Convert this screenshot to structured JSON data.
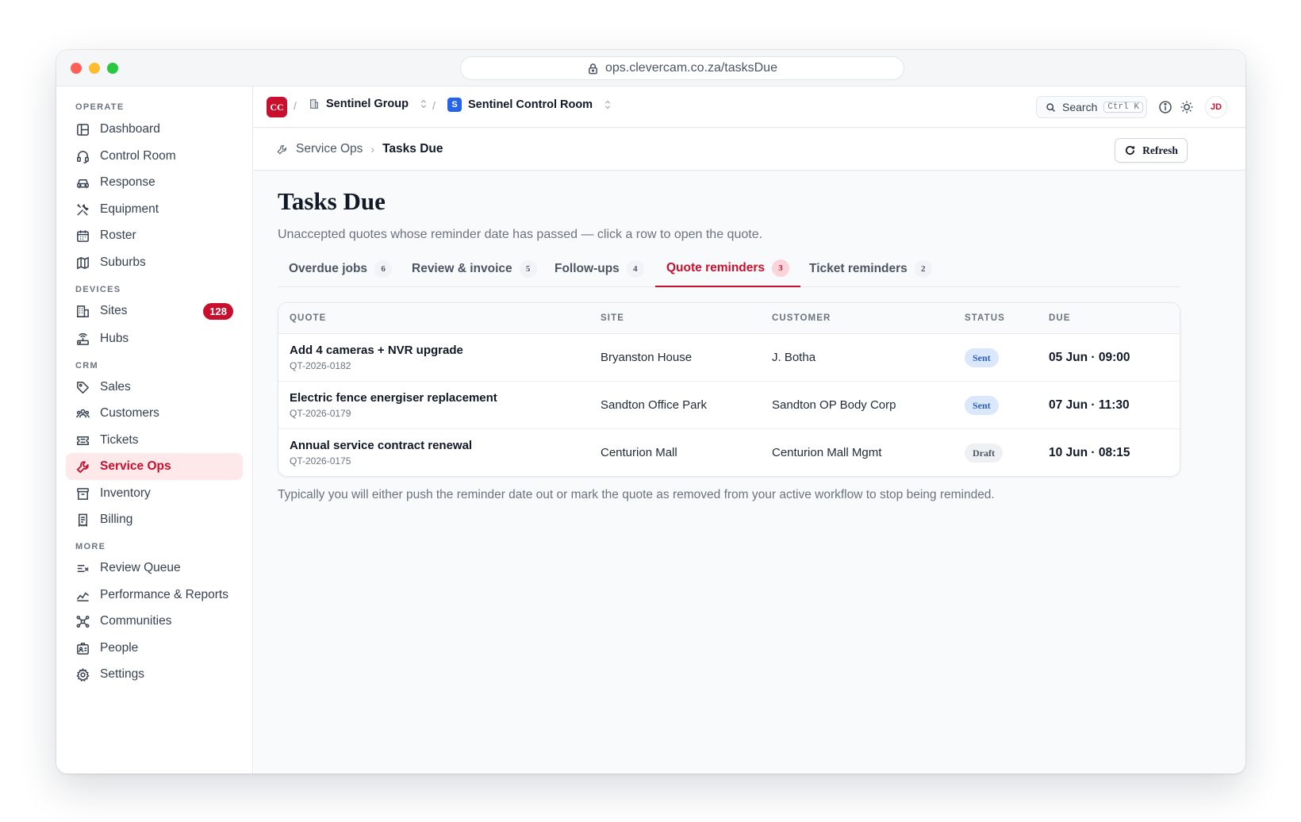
{
  "browser": {
    "url": "ops.clevercam.co.za/tasksDue"
  },
  "sidebar": {
    "sections": [
      {
        "label": "OPERATE",
        "items": [
          {
            "label": "Dashboard",
            "icon": "dashboard-icon"
          },
          {
            "label": "Control Room",
            "icon": "headset-icon"
          },
          {
            "label": "Response",
            "icon": "car-icon"
          },
          {
            "label": "Equipment",
            "icon": "tools-icon"
          },
          {
            "label": "Roster",
            "icon": "calendar-icon"
          },
          {
            "label": "Suburbs",
            "icon": "map-icon"
          }
        ]
      },
      {
        "label": "DEVICES",
        "items": [
          {
            "label": "Sites",
            "icon": "building-icon",
            "badge": "128"
          },
          {
            "label": "Hubs",
            "icon": "router-icon"
          }
        ]
      },
      {
        "label": "CRM",
        "items": [
          {
            "label": "Sales",
            "icon": "tag-icon"
          },
          {
            "label": "Customers",
            "icon": "users-icon"
          },
          {
            "label": "Tickets",
            "icon": "ticket-icon"
          },
          {
            "label": "Service Ops",
            "icon": "wrench-icon",
            "active": true
          },
          {
            "label": "Inventory",
            "icon": "archive-icon"
          },
          {
            "label": "Billing",
            "icon": "receipt-icon"
          }
        ]
      },
      {
        "label": "MORE",
        "items": [
          {
            "label": "Review Queue",
            "icon": "list-check-icon"
          },
          {
            "label": "Performance & Reports",
            "icon": "trend-icon"
          },
          {
            "label": "Communities",
            "icon": "network-icon"
          },
          {
            "label": "People",
            "icon": "id-card-icon"
          },
          {
            "label": "Settings",
            "icon": "gear-icon"
          }
        ]
      }
    ]
  },
  "topbar": {
    "logo": "CC",
    "separator": "/",
    "org": "Sentinel Group",
    "workspace_badge": "S",
    "workspace": "Sentinel Control Room",
    "search_label": "Search",
    "search_shortcut": "Ctrl K",
    "avatar": "JD"
  },
  "subbar": {
    "parent": "Service Ops",
    "chevron": "›",
    "current": "Tasks Due",
    "refresh_label": "Refresh"
  },
  "page": {
    "title": "Tasks Due",
    "subtitle": "Unaccepted quotes whose reminder date has passed — click a row to open the quote.",
    "footnote": "Typically you will either push the reminder date out or mark the quote as removed from your active workflow to stop being reminded."
  },
  "tabs": [
    {
      "label": "Overdue jobs",
      "count": "6"
    },
    {
      "label": "Review & invoice",
      "count": "5"
    },
    {
      "label": "Follow-ups",
      "count": "4"
    },
    {
      "label": "Quote reminders",
      "count": "3",
      "active": true
    },
    {
      "label": "Ticket reminders",
      "count": "2"
    }
  ],
  "table": {
    "headers": [
      "QUOTE",
      "SITE",
      "CUSTOMER",
      "STATUS",
      "DUE"
    ],
    "rows": [
      {
        "title": "Add 4 cameras + NVR upgrade",
        "id": "QT-2026-0182",
        "site": "Bryanston House",
        "customer": "J. Botha",
        "status": "Sent",
        "due": "05 Jun · 09:00"
      },
      {
        "title": "Electric fence energiser replacement",
        "id": "QT-2026-0179",
        "site": "Sandton Office Park",
        "customer": "Sandton OP Body Corp",
        "status": "Sent",
        "due": "07 Jun · 11:30"
      },
      {
        "title": "Annual service contract renewal",
        "id": "QT-2026-0175",
        "site": "Centurion Mall",
        "customer": "Centurion Mall Mgmt",
        "status": "Draft",
        "due": "10 Jun · 08:15"
      }
    ]
  },
  "colors": {
    "accent": "#c8102e",
    "sent_badge": "#dbe7fb",
    "draft_badge": "#eef0f3",
    "workspace_badge": "#2563eb"
  }
}
